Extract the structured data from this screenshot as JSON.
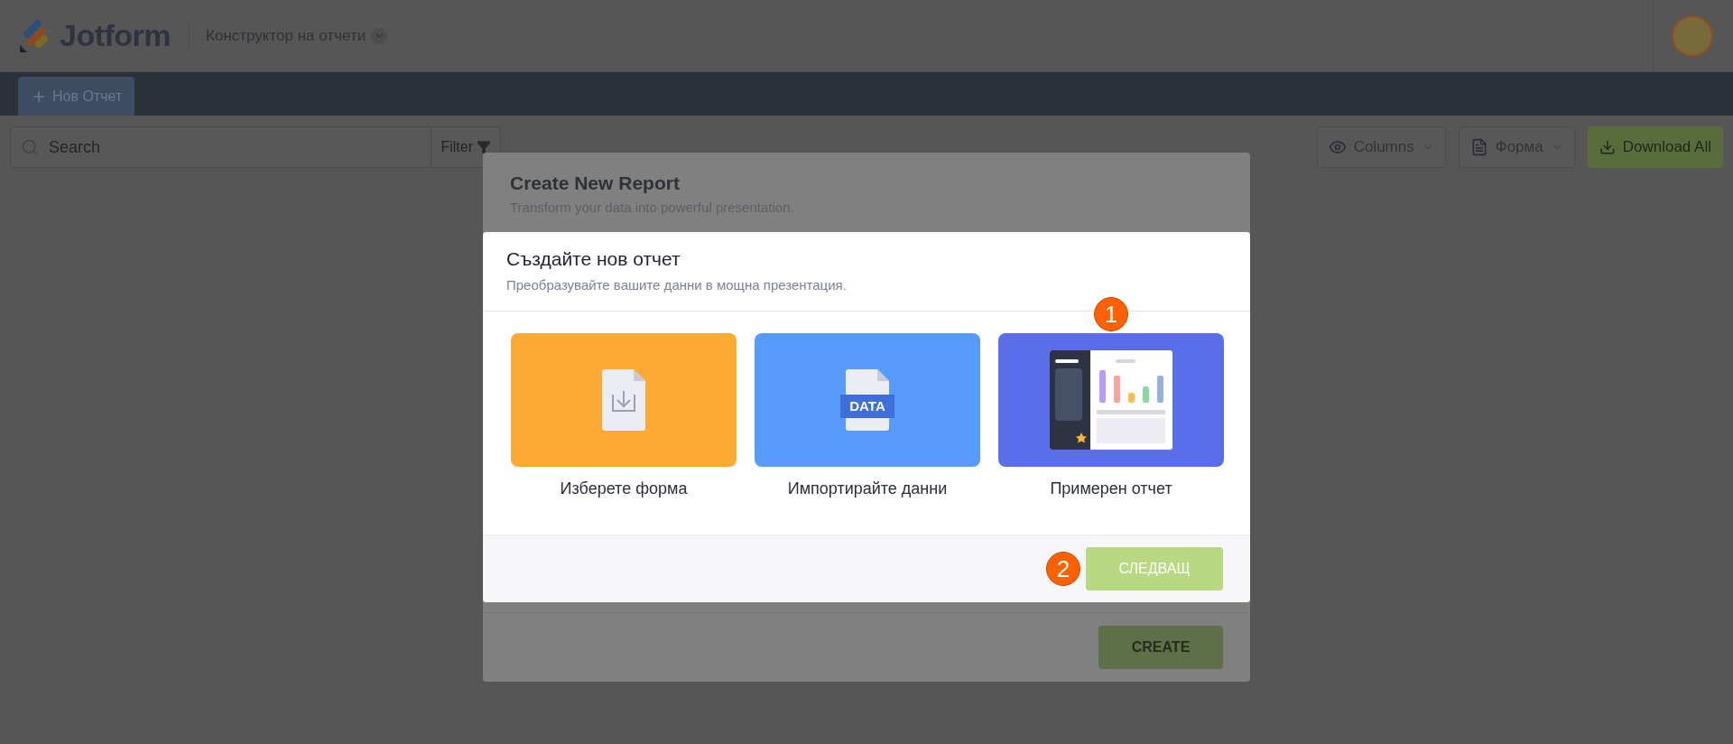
{
  "header": {
    "logo": "Jotform",
    "app_switcher": "Конструктор на отчети"
  },
  "toolbar": {
    "new_button": "Нов Отчет"
  },
  "filter_bar": {
    "search": {
      "placeholder": "Search"
    },
    "filter_button": "Filter",
    "columns_button": "Columns",
    "form_button": "Форма",
    "download_button": "Download All"
  },
  "background_dialog": {
    "title": "Create New Report",
    "subtitle": "Transform your data into powerful presentation.",
    "create_button": "CREATE"
  },
  "dialog": {
    "title": "Създайте нов отчет",
    "subtitle": "Преобразувайте вашите данни в мощна презентация.",
    "options": [
      {
        "kind": "form",
        "label": "Изберете форма"
      },
      {
        "kind": "import",
        "label": "Импортирайте данни",
        "icon_text": "DATA"
      },
      {
        "kind": "sample",
        "label": "Примерен отчет",
        "callout": "1"
      }
    ],
    "next_button": "СЛЕДВАЩ",
    "next_callout": "2"
  }
}
